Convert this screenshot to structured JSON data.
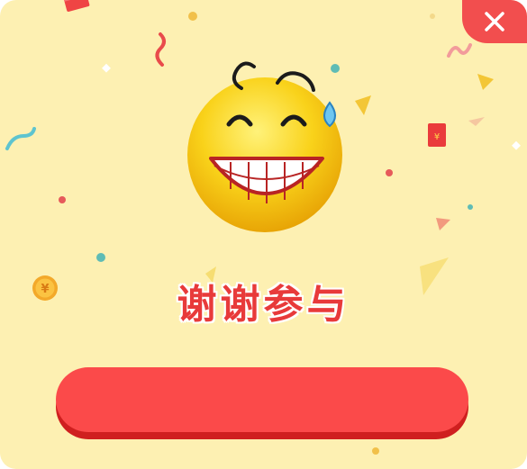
{
  "dialog": {
    "title": "谢谢参与",
    "action_label": "",
    "close_icon": "close-icon",
    "emoji_icon": "grinning-sweat-emoji-icon"
  },
  "colors": {
    "panel_background": "#fdf0b2",
    "accent_red": "#f24e4e",
    "title_red": "#e83a3a"
  },
  "decorations": {
    "coin_symbol": "¥",
    "red_packet_symbol": "¥"
  }
}
